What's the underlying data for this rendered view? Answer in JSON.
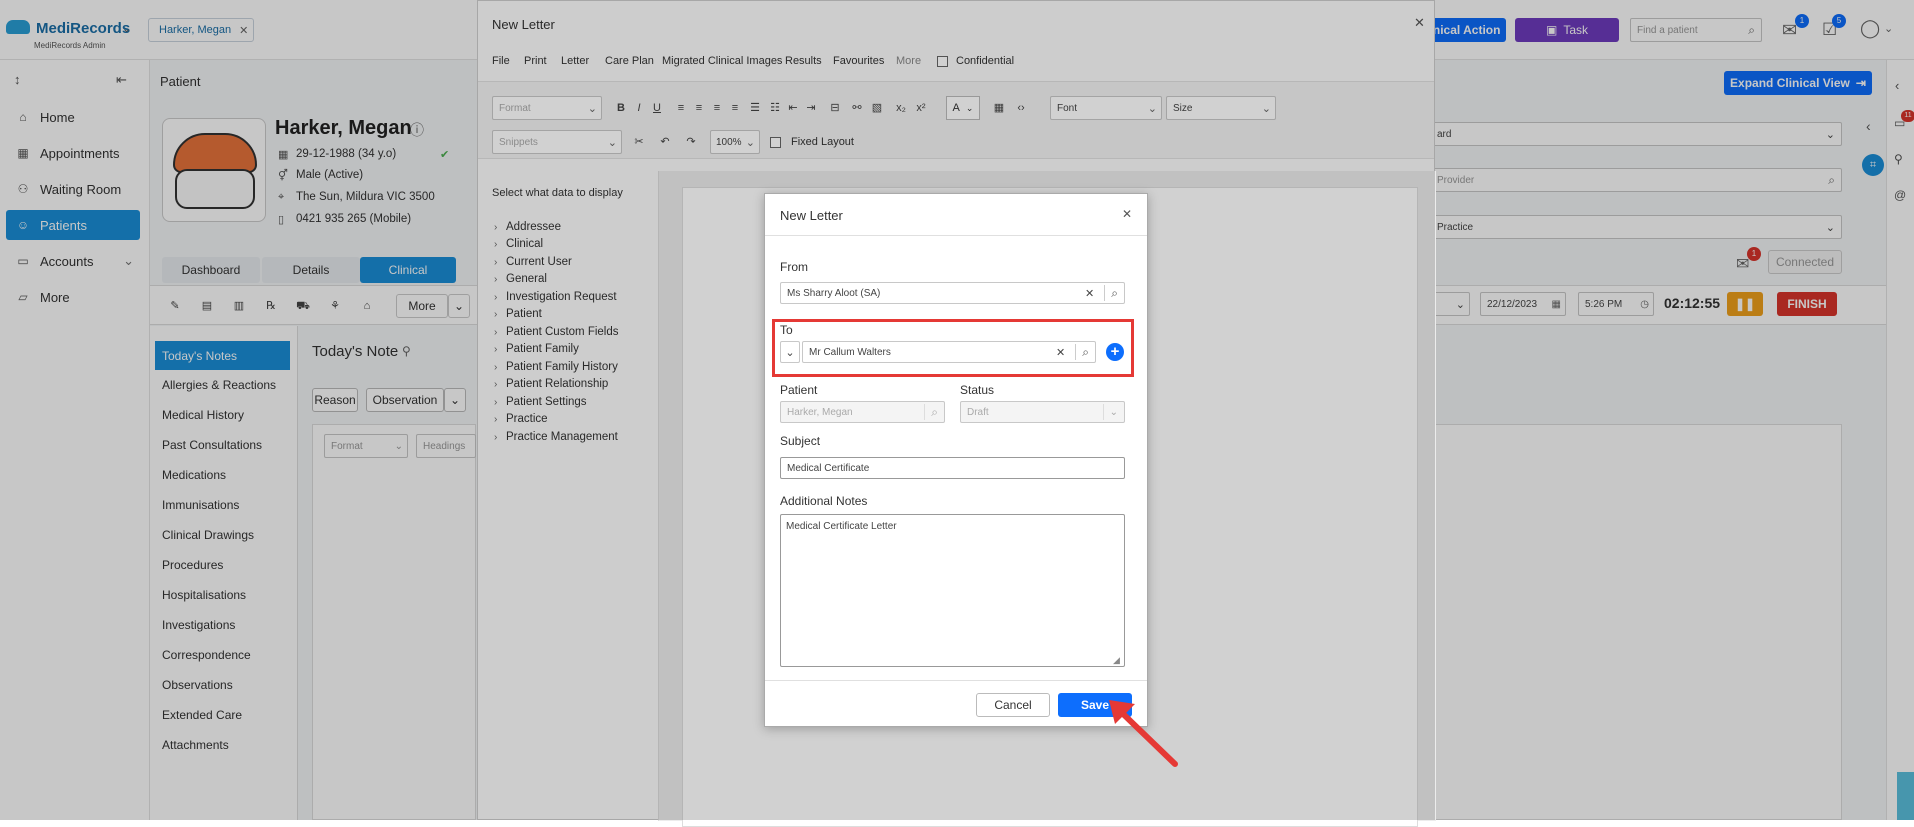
{
  "app": {
    "brand": "MediRecords",
    "subtitle": "MediRecords Admin"
  },
  "header": {
    "patient_tab": "Harker, Megan",
    "clinical_action_label": "Clinical Action",
    "task_label": "Task",
    "search_placeholder": "Find a patient",
    "mail_badge": "1",
    "tasks_badge": "5"
  },
  "sidebar": {
    "items": [
      {
        "label": "Home",
        "icon": "home-icon"
      },
      {
        "label": "Appointments",
        "icon": "calendar-icon"
      },
      {
        "label": "Waiting Room",
        "icon": "people-icon"
      },
      {
        "label": "Patients",
        "icon": "patient-icon"
      },
      {
        "label": "Accounts",
        "icon": "wallet-icon"
      },
      {
        "label": "More",
        "icon": "folder-icon"
      }
    ]
  },
  "patient": {
    "section_label": "Patient",
    "name": "Harker, Megan",
    "dob": "29-12-1988 (34 y.o)",
    "gender": "Male (Active)",
    "address": "The Sun, Mildura VIC 3500",
    "phone": "0421 935 265 (Mobile)",
    "tabs": [
      "Dashboard",
      "Details",
      "Clinical"
    ],
    "more_label": "More",
    "left_nav": [
      "Today's Notes",
      "Allergies & Reactions",
      "Medical History",
      "Past Consultations",
      "Medications",
      "Immunisations",
      "Clinical Drawings",
      "Procedures",
      "Hospitalisations",
      "Investigations",
      "Correspondence",
      "Observations",
      "Extended Care",
      "Attachments"
    ],
    "today_note_title": "Today's Note",
    "reason_label": "Reason",
    "observation_label": "Observation",
    "format_label": "Format",
    "headings_label": "Headings"
  },
  "right_panel": {
    "expand_label": "Expand Clinical View",
    "field1": "ard",
    "field2": "Provider",
    "field3": "Practice",
    "connected_label": "Connected",
    "notif_badge": "1",
    "side_badge": "11",
    "date": "22/12/2023",
    "time": "5:26 PM",
    "timer": "02:12:55",
    "finish_label": "FINISH"
  },
  "letter_window": {
    "title": "New Letter",
    "menu": [
      "File",
      "Print",
      "Letter",
      "Care Plan",
      "Migrated Clinical Images",
      "Results",
      "Favourites",
      "More"
    ],
    "confidential_label": "Confidential",
    "format_label": "Format",
    "font_label": "Font",
    "size_label": "Size",
    "snippets_label": "Snippets",
    "zoom": "100%",
    "fixed_layout_label": "Fixed Layout",
    "data_title": "Select what data to display",
    "data_items": [
      "Addressee",
      "Clinical",
      "Current User",
      "General",
      "Investigation Request",
      "Patient",
      "Patient Custom Fields",
      "Patient Family",
      "Patient Family History",
      "Patient Relationship",
      "Patient Settings",
      "Practice",
      "Practice Management"
    ]
  },
  "dialog": {
    "title": "New Letter",
    "from_label": "From",
    "from_value": "Ms Sharry Aloot (SA)",
    "to_label": "To",
    "to_value": "Mr Callum Walters",
    "patient_label": "Patient",
    "patient_value": "Harker, Megan",
    "status_label": "Status",
    "status_value": "Draft",
    "subject_label": "Subject",
    "subject_value": "Medical Certificate",
    "notes_label": "Additional Notes",
    "notes_value": "Medical Certificate Letter",
    "cancel_label": "Cancel",
    "save_label": "Save"
  },
  "colors": {
    "brand_blue": "#1a8fd9",
    "primary": "#0d6efd",
    "purple": "#6f3bbf",
    "highlight": "#e53935",
    "finish": "#d9342b",
    "pause": "#f0a11c"
  }
}
